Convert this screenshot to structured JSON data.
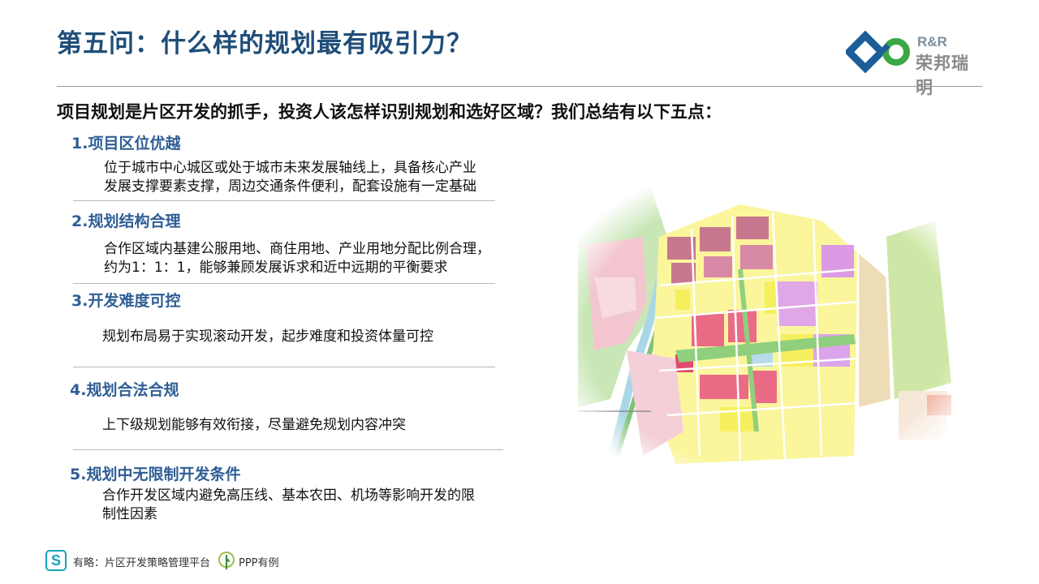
{
  "header": {
    "title": "第五问：什么样的规划最有吸引力？",
    "logo_en": "R&R",
    "logo_cn": "荣邦瑞明"
  },
  "intro": "项目规划是片区开发的抓手，投资人该怎样识别规划和选好区域？我们总结有以下五点：",
  "items": [
    {
      "heading": "1.项目区位优越",
      "line1": "位于城市中心城区或处于城市未来发展轴线上，具备核心产业",
      "line2": "发展支撑要素支撑，周边交通条件便利，配套设施有一定基础"
    },
    {
      "heading": "2.规划结构合理",
      "line1": "合作区域内基建公服用地、商住用地、产业用地分配比例合理，",
      "line2": "约为1：1：1，能够兼顾发展诉求和近中远期的平衡要求"
    },
    {
      "heading": "3.开发难度可控",
      "line1": "规划布局易于实现滚动开发，起步难度和投资体量可控",
      "line2": ""
    },
    {
      "heading": "4.规划合法合规",
      "line1": "上下级规划能够有效衔接，尽量避免规划内容冲突",
      "line2": ""
    },
    {
      "heading": "5.规划中无限制开发条件",
      "line1": "合作开发区域内避免高压线、基本农田、机场等影响开发的限",
      "line2": "制性因素"
    }
  ],
  "footer": {
    "icon1": "S",
    "text1": "有略：片区开发策略管理平台",
    "text2": "PPP有例"
  },
  "colors": {
    "title": "#1f4e79",
    "heading": "#2f5e95",
    "logo_blue": "#1b5e9a",
    "logo_green": "#3aa845",
    "footer_teal": "#17a3b8"
  }
}
